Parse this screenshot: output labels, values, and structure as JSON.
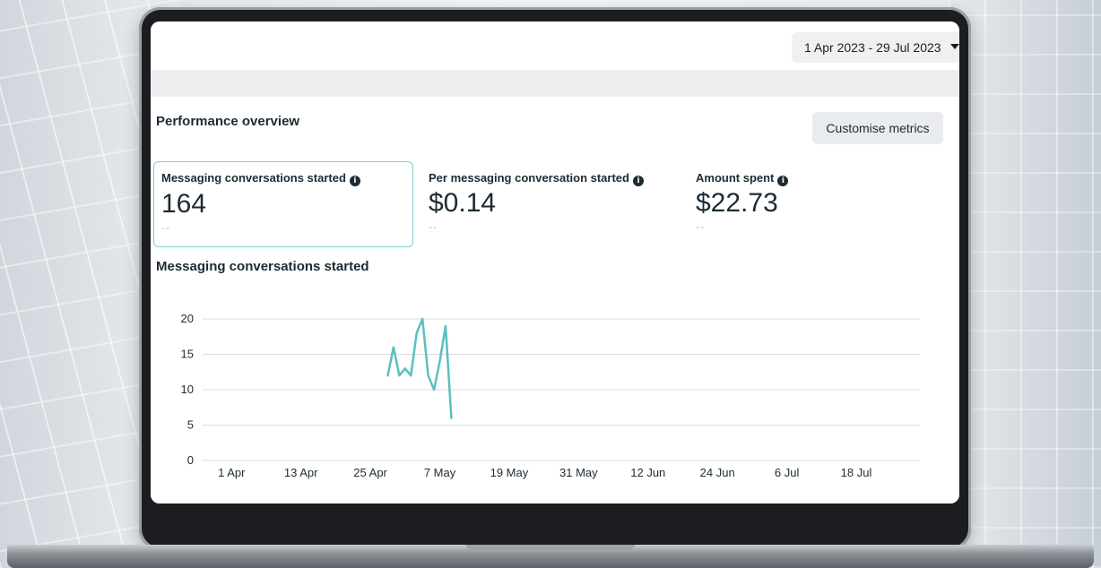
{
  "header": {
    "date_range": "1 Apr 2023 - 29 Jul 2023"
  },
  "overview": {
    "title": "Performance overview",
    "customise_label": "Customise metrics"
  },
  "metrics": [
    {
      "label": "Messaging conversations started",
      "value": "164",
      "compare": "--"
    },
    {
      "label": "Per messaging conversation started",
      "value": "$0.14",
      "compare": "--"
    },
    {
      "label": "Amount spent",
      "value": "$22.73",
      "compare": "--"
    }
  ],
  "icons": {
    "info": "info-icon",
    "dropdown": "chevron-down-icon"
  },
  "colors": {
    "line": "#5bc0c0",
    "selected_border": "#7ccfcf"
  },
  "chart_title": "Messaging conversations started",
  "chart_data": {
    "type": "line",
    "title": "Messaging conversations started",
    "xlabel": "",
    "ylabel": "",
    "x_ticks": [
      "1 Apr",
      "13 Apr",
      "25 Apr",
      "7 May",
      "19 May",
      "31 May",
      "12 Jun",
      "24 Jun",
      "6 Jul",
      "18 Jul"
    ],
    "y_ticks": [
      0,
      5,
      10,
      15,
      20
    ],
    "ylim": [
      0,
      20
    ],
    "xlim": [
      "2023-03-27",
      "2023-07-29"
    ],
    "grid": true,
    "series": [
      {
        "x": [
          "2023-04-28",
          "2023-04-29",
          "2023-04-30",
          "2023-05-01",
          "2023-05-02",
          "2023-05-03",
          "2023-05-04",
          "2023-05-05",
          "2023-05-06",
          "2023-05-07",
          "2023-05-08",
          "2023-05-09"
        ],
        "values": [
          12,
          16,
          12,
          13,
          12,
          18,
          20,
          12,
          10,
          14,
          19,
          6
        ]
      }
    ]
  }
}
